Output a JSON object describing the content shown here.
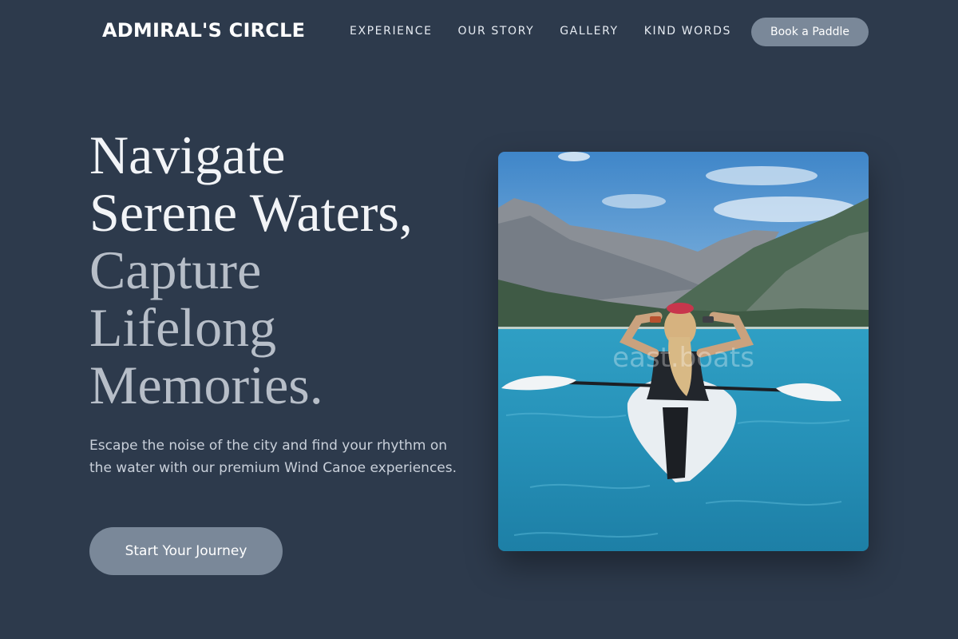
{
  "brand": {
    "name": "ADMIRAL'S CIRCLE"
  },
  "nav": {
    "items": [
      {
        "label": "EXPERIENCE"
      },
      {
        "label": "OUR STORY"
      },
      {
        "label": "GALLERY"
      },
      {
        "label": "KIND WORDS"
      }
    ],
    "cta_label": "Book a Paddle"
  },
  "hero": {
    "title_line1": "Navigate",
    "title_line2": "Serene Waters,",
    "title_line3": "Capture",
    "title_line4": "Lifelong",
    "title_line5": "Memories.",
    "subtitle": "Escape the noise of the city and find your rhythm on the water with our premium Wind Canoe experiences.",
    "cta_label": "Start Your Journey"
  },
  "image": {
    "watermark": "east.boats"
  },
  "colors": {
    "background": "#2d3a4c",
    "button": "#7a8899",
    "accent_text": "#b7bec8"
  }
}
